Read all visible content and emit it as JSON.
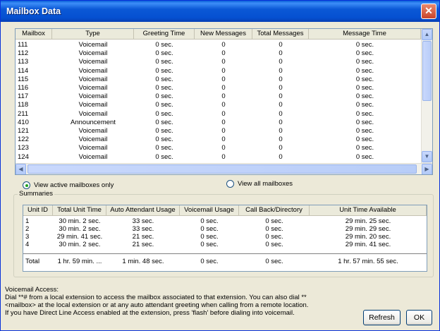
{
  "window": {
    "title": "Mailbox Data",
    "close_glyph": "✕"
  },
  "mailboxes": {
    "columns": [
      "Mailbox",
      "Type",
      "Greeting Time",
      "New Messages",
      "Total Messages",
      "Message Time"
    ],
    "rows": [
      [
        "111",
        "Voicemail",
        "0 sec.",
        "0",
        "0",
        "0 sec."
      ],
      [
        "112",
        "Voicemail",
        "0 sec.",
        "0",
        "0",
        "0 sec."
      ],
      [
        "113",
        "Voicemail",
        "0 sec.",
        "0",
        "0",
        "0 sec."
      ],
      [
        "114",
        "Voicemail",
        "0 sec.",
        "0",
        "0",
        "0 sec."
      ],
      [
        "115",
        "Voicemail",
        "0 sec.",
        "0",
        "0",
        "0 sec."
      ],
      [
        "116",
        "Voicemail",
        "0 sec.",
        "0",
        "0",
        "0 sec."
      ],
      [
        "117",
        "Voicemail",
        "0 sec.",
        "0",
        "0",
        "0 sec."
      ],
      [
        "118",
        "Voicemail",
        "0 sec.",
        "0",
        "0",
        "0 sec."
      ],
      [
        "211",
        "Voicemail",
        "0 sec.",
        "0",
        "0",
        "0 sec."
      ],
      [
        "410",
        "Announcement",
        "0 sec.",
        "0",
        "0",
        "0 sec."
      ],
      [
        "121",
        "Voicemail",
        "0 sec.",
        "0",
        "0",
        "0 sec."
      ],
      [
        "122",
        "Voicemail",
        "0 sec.",
        "0",
        "0",
        "0 sec."
      ],
      [
        "123",
        "Voicemail",
        "0 sec.",
        "0",
        "0",
        "0 sec."
      ],
      [
        "124",
        "Voicemail",
        "0 sec.",
        "0",
        "0",
        "0 sec."
      ]
    ],
    "scroll_up_glyph": "▲",
    "scroll_down_glyph": "▼",
    "scroll_left_glyph": "◀",
    "scroll_right_glyph": "▶"
  },
  "view_options": {
    "active_label": "View active mailboxes only",
    "all_label": "View all mailboxes",
    "selected": "active"
  },
  "summaries": {
    "group_label": "Summaries",
    "columns": [
      "Unit ID",
      "Total Unit Time",
      "Auto Attendant Usage",
      "Voicemail Usage",
      "Call Back/Directory",
      "Unit Time Available"
    ],
    "rows": [
      [
        "1",
        "30 min. 2 sec.",
        "33 sec.",
        "0 sec.",
        "0 sec.",
        "29 min. 25 sec."
      ],
      [
        "2",
        "30 min. 2 sec.",
        "33 sec.",
        "0 sec.",
        "0 sec.",
        "29 min. 29 sec."
      ],
      [
        "3",
        "29 min. 41 sec.",
        "21 sec.",
        "0 sec.",
        "0 sec.",
        "29 min. 20 sec."
      ],
      [
        "4",
        "30 min. 2 sec.",
        "21 sec.",
        "0 sec.",
        "0 sec.",
        "29 min. 41 sec."
      ]
    ],
    "total": [
      "Total",
      "1 hr. 59 min. ...",
      "1 min. 48 sec.",
      "0 sec.",
      "0 sec.",
      "1 hr. 57 min. 55 sec."
    ]
  },
  "voicemail_access": {
    "heading": "Voicemail Access:",
    "lines": [
      "Dial **# from a local extension to access the mailbox associated to that extension. You can also dial **",
      "<mailbox> at the local extension or at any auto attendant greeting when calling from a remote location.",
      "If you have Direct Line Access enabled at the extension, press 'flash' before dialing into voicemail."
    ]
  },
  "buttons": {
    "refresh": "Refresh",
    "ok": "OK"
  }
}
